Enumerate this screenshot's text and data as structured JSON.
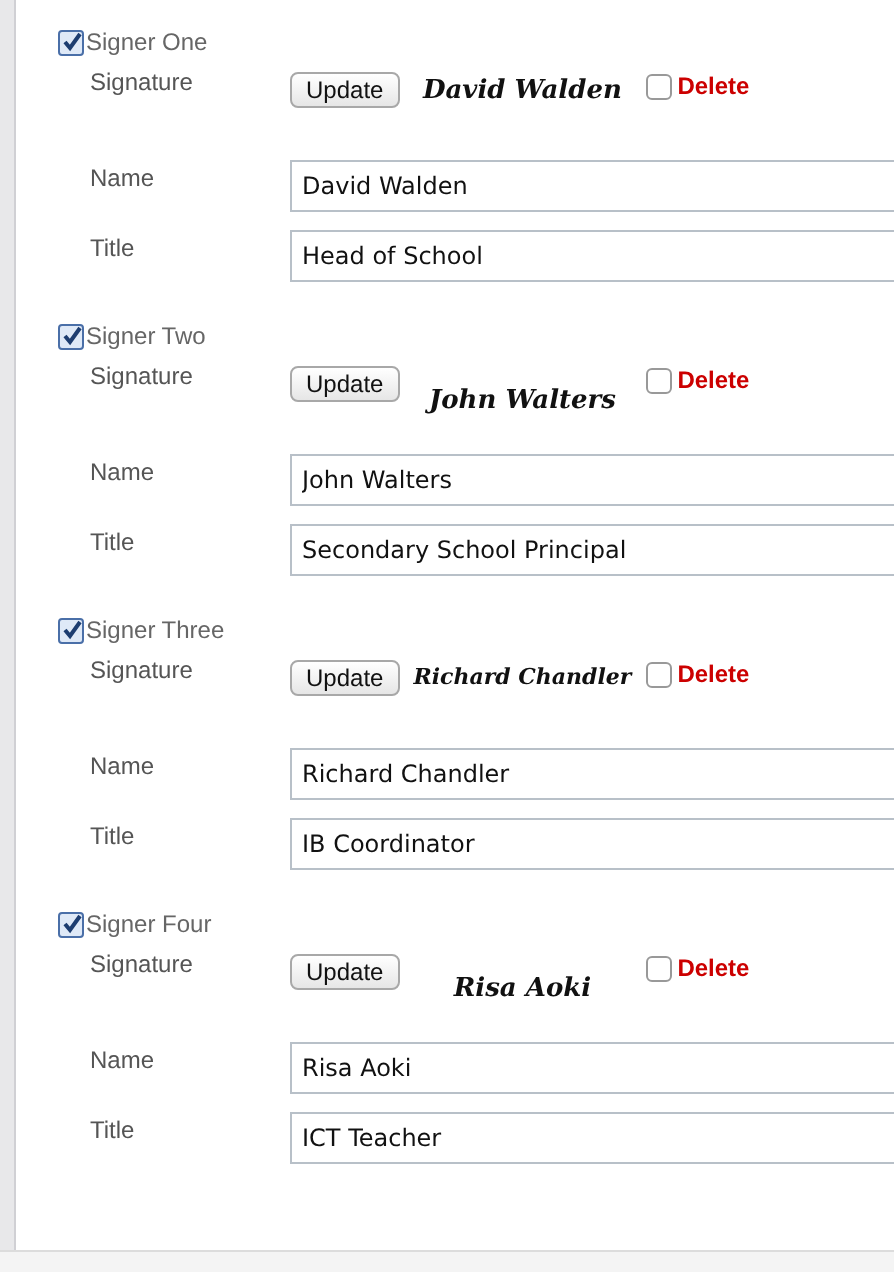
{
  "signers": [
    {
      "label": "Signer One",
      "checked": true,
      "signature_label": "Signature",
      "update_button": "Update",
      "signature": "David Walden",
      "delete": {
        "label": "Delete",
        "checked": false
      },
      "name_label": "Name",
      "name": "David Walden",
      "title_label": "Title",
      "title": "Head of School"
    },
    {
      "label": "Signer Two",
      "checked": true,
      "signature_label": "Signature",
      "update_button": "Update",
      "signature": "John Walters",
      "delete": {
        "label": "Delete",
        "checked": false
      },
      "name_label": "Name",
      "name": "John Walters",
      "title_label": "Title",
      "title": "Secondary School Principal"
    },
    {
      "label": "Signer Three",
      "checked": true,
      "signature_label": "Signature",
      "update_button": "Update",
      "signature": "Richard Chandler",
      "delete": {
        "label": "Delete",
        "checked": false
      },
      "name_label": "Name",
      "name": "Richard Chandler",
      "title_label": "Title",
      "title": "IB Coordinator"
    },
    {
      "label": "Signer Four",
      "checked": true,
      "signature_label": "Signature",
      "update_button": "Update",
      "signature": "Risa Aoki",
      "delete": {
        "label": "Delete",
        "checked": false
      },
      "name_label": "Name",
      "name": "Risa Aoki",
      "title_label": "Title",
      "title": "ICT Teacher"
    }
  ]
}
